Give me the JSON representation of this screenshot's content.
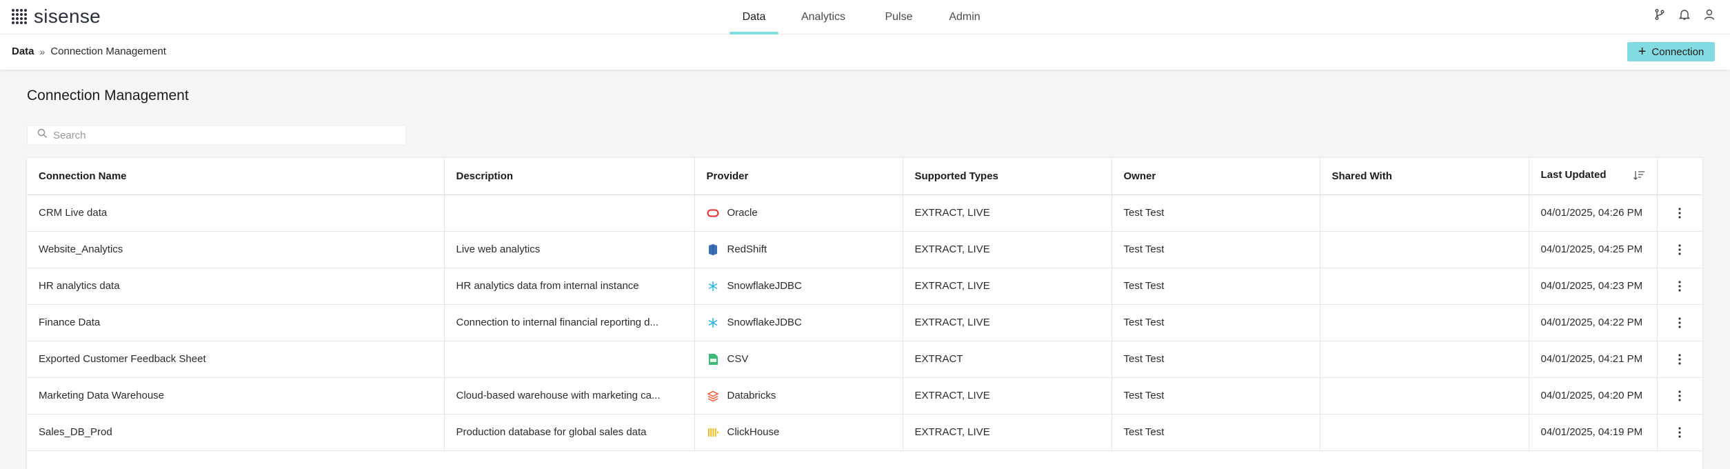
{
  "app": {
    "logo_text": "sisense"
  },
  "nav": {
    "tabs": [
      {
        "label": "Data",
        "active": true
      },
      {
        "label": "Analytics",
        "active": false
      },
      {
        "label": "Pulse",
        "active": false
      },
      {
        "label": "Admin",
        "active": false
      }
    ],
    "icons": [
      "branch-icon",
      "bell-icon",
      "user-icon"
    ]
  },
  "breadcrumb": {
    "root": "Data",
    "separator": "»",
    "current": "Connection Management"
  },
  "actions": {
    "add_connection_label": "Connection"
  },
  "page": {
    "title": "Connection Management"
  },
  "search": {
    "placeholder": "Search",
    "value": ""
  },
  "table": {
    "columns": [
      "Connection Name",
      "Description",
      "Provider",
      "Supported Types",
      "Owner",
      "Shared With",
      "Last Updated"
    ],
    "rows": [
      {
        "name": "CRM Live data",
        "description": "",
        "provider": "Oracle",
        "provider_icon": "oracle-icon",
        "types": "EXTRACT, LIVE",
        "owner": "Test Test",
        "shared": "",
        "updated": "04/01/2025, 04:26 PM"
      },
      {
        "name": "Website_Analytics",
        "description": "Live web analytics",
        "provider": "RedShift",
        "provider_icon": "redshift-icon",
        "types": "EXTRACT, LIVE",
        "owner": "Test Test",
        "shared": "",
        "updated": "04/01/2025, 04:25 PM"
      },
      {
        "name": "HR analytics data",
        "description": "HR analytics data from internal instance",
        "provider": "SnowflakeJDBC",
        "provider_icon": "snowflake-icon",
        "types": "EXTRACT, LIVE",
        "owner": "Test Test",
        "shared": "",
        "updated": "04/01/2025, 04:23 PM"
      },
      {
        "name": "Finance Data",
        "description": "Connection to internal financial reporting d...",
        "provider": "SnowflakeJDBC",
        "provider_icon": "snowflake-icon",
        "types": "EXTRACT, LIVE",
        "owner": "Test Test",
        "shared": "",
        "updated": "04/01/2025, 04:22 PM"
      },
      {
        "name": "Exported Customer Feedback Sheet",
        "description": "",
        "provider": "CSV",
        "provider_icon": "csv-icon",
        "types": "EXTRACT",
        "owner": "Test Test",
        "shared": "",
        "updated": "04/01/2025, 04:21 PM"
      },
      {
        "name": "Marketing Data Warehouse",
        "description": "Cloud-based warehouse with marketing ca...",
        "provider": "Databricks",
        "provider_icon": "databricks-icon",
        "types": "EXTRACT, LIVE",
        "owner": "Test Test",
        "shared": "",
        "updated": "04/01/2025, 04:20 PM"
      },
      {
        "name": "Sales_DB_Prod",
        "description": "Production database for global sales data",
        "provider": "ClickHouse",
        "provider_icon": "clickhouse-icon",
        "types": "EXTRACT, LIVE",
        "owner": "Test Test",
        "shared": "",
        "updated": "04/01/2025, 04:19 PM"
      }
    ]
  },
  "colors": {
    "accent": "#82dbe0",
    "oracle": "#e32d2d",
    "redshift": "#3c6fb4",
    "snowflake": "#29b5e8",
    "csv": "#3cb878",
    "databricks": "#ef5a3c",
    "clickhouse": "#f2b705"
  }
}
